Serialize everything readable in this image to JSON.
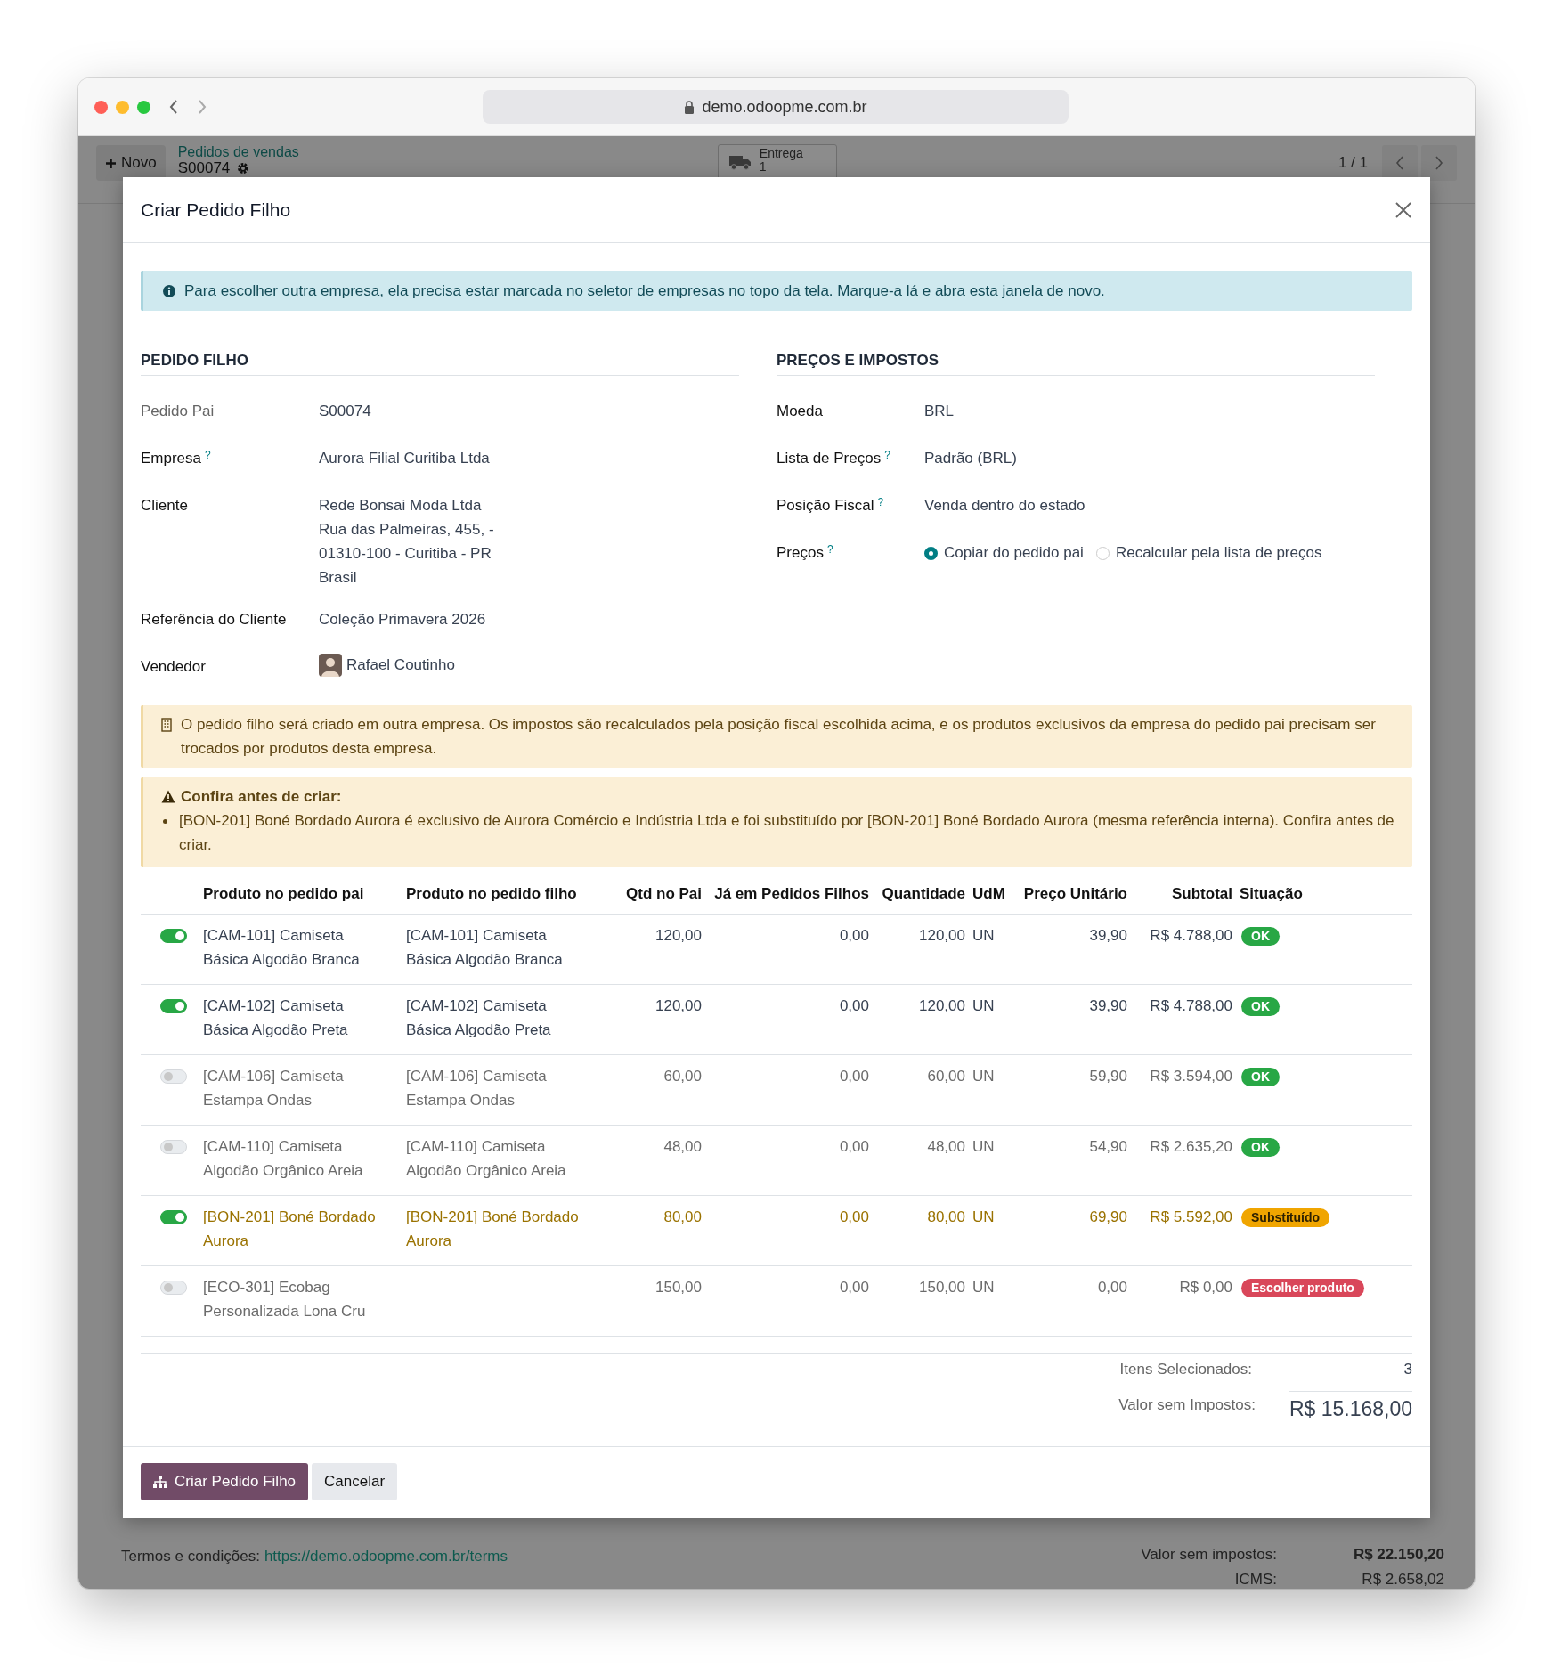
{
  "browser": {
    "url": "demo.odoopme.com.br"
  },
  "background": {
    "new_button": "Novo",
    "breadcrumb": "Pedidos de vendas",
    "record": "S00074",
    "smart_button": {
      "label": "Entrega",
      "count": "1"
    },
    "pager": "1 / 1",
    "terms_label": "Termos e condições:",
    "terms_link": "https://demo.odoopme.com.br/terms",
    "totals": [
      {
        "label": "Valor sem impostos:",
        "value": "R$ 22.150,20",
        "strong": true
      },
      {
        "label": "ICMS:",
        "value": "R$ 2.658,02",
        "strong": false
      }
    ]
  },
  "dialog": {
    "title": "Criar Pedido Filho",
    "info": "Para escolher outra empresa, ela precisa estar marcada no seletor de empresas no topo da tela. Marque-a lá e abra esta janela de novo.",
    "left_section": {
      "title": "PEDIDO FILHO",
      "fields": [
        {
          "label": "Pedido Pai",
          "muted": true,
          "kind": "text",
          "value": "S00074"
        },
        {
          "label": "Empresa",
          "help": "?",
          "muted": false,
          "kind": "text",
          "value": "Aurora Filial Curitiba Ltda"
        },
        {
          "label": "Cliente",
          "muted": false,
          "kind": "address",
          "lines": [
            "Rede Bonsai Moda Ltda",
            "Rua das Palmeiras, 455, -",
            "01310-100 - Curitiba - PR",
            "Brasil"
          ]
        },
        {
          "label": "Referência do Cliente",
          "muted": false,
          "kind": "text",
          "value": "Coleção Primavera 2026"
        },
        {
          "label": "Vendedor",
          "muted": false,
          "kind": "user",
          "value": "Rafael Coutinho"
        }
      ]
    },
    "right_section": {
      "title": "PREÇOS E IMPOSTOS",
      "fields": [
        {
          "label": "Moeda",
          "muted": false,
          "kind": "text",
          "value": "BRL"
        },
        {
          "label": "Lista de Preços",
          "help": "?",
          "muted": false,
          "kind": "text",
          "value": "Padrão (BRL)"
        },
        {
          "label": "Posição Fiscal",
          "help": "?",
          "muted": false,
          "kind": "text",
          "value": "Venda dentro do estado"
        },
        {
          "label": "Preços",
          "help": "?",
          "muted": false,
          "kind": "radio",
          "options": [
            {
              "label": "Copiar do pedido pai",
              "selected": true
            },
            {
              "label": "Recalcular pela lista de preços",
              "selected": false
            }
          ]
        }
      ]
    },
    "company_notice": "O pedido filho será criado em outra empresa. Os impostos são recalculados pela posição fiscal escolhida acima, e os produtos exclusivos da empresa do pedido pai precisam ser trocados por produtos desta empresa.",
    "check_notice": {
      "title": "Confira antes de criar:",
      "items": [
        "[BON-201] Boné Bordado Aurora é exclusivo de Aurora Comércio e Indústria Ltda e foi substituído por [BON-201] Boné Bordado Aurora (mesma referência interna). Confira antes de criar."
      ]
    },
    "table": {
      "columns": [
        "Produto no pedido pai",
        "Produto no pedido filho",
        "Qtd no Pai",
        "Já em Pedidos Filhos",
        "Quantidade",
        "UdM",
        "Preço Unitário",
        "Subtotal",
        "Situação"
      ],
      "rows": [
        {
          "selected": true,
          "parent_product": "[CAM-101] Camiseta Básica Algodão Branca",
          "child_product": "[CAM-101] Camiseta Básica Algodão Branca",
          "qty_parent": "120,00",
          "already": "0,00",
          "quantity": "120,00",
          "uom": "UN",
          "unit_price": "39,90",
          "subtotal": "R$ 4.788,00",
          "status": {
            "label": "OK",
            "kind": "ok"
          }
        },
        {
          "selected": true,
          "parent_product": "[CAM-102] Camiseta Básica Algodão Preta",
          "child_product": "[CAM-102] Camiseta Básica Algodão Preta",
          "qty_parent": "120,00",
          "already": "0,00",
          "quantity": "120,00",
          "uom": "UN",
          "unit_price": "39,90",
          "subtotal": "R$ 4.788,00",
          "status": {
            "label": "OK",
            "kind": "ok"
          }
        },
        {
          "selected": false,
          "parent_product": "[CAM-106] Camiseta Estampa Ondas",
          "child_product": "[CAM-106] Camiseta Estampa Ondas",
          "qty_parent": "60,00",
          "already": "0,00",
          "quantity": "60,00",
          "uom": "UN",
          "unit_price": "59,90",
          "subtotal": "R$ 3.594,00",
          "status": {
            "label": "OK",
            "kind": "ok"
          }
        },
        {
          "selected": false,
          "parent_product": "[CAM-110] Camiseta Algodão Orgânico Areia",
          "child_product": "[CAM-110] Camiseta Algodão Orgânico Areia",
          "qty_parent": "48,00",
          "already": "0,00",
          "quantity": "48,00",
          "uom": "UN",
          "unit_price": "54,90",
          "subtotal": "R$ 2.635,20",
          "status": {
            "label": "OK",
            "kind": "ok"
          }
        },
        {
          "selected": true,
          "parent_product": "[BON-201] Boné Bordado Aurora",
          "child_product": "[BON-201] Boné Bordado Aurora",
          "qty_parent": "80,00",
          "already": "0,00",
          "quantity": "80,00",
          "uom": "UN",
          "unit_price": "69,90",
          "subtotal": "R$ 5.592,00",
          "status": {
            "label": "Substituído",
            "kind": "replaced"
          }
        },
        {
          "selected": false,
          "parent_product": "[ECO-301] Ecobag Personalizada Lona Cru",
          "qty_parent": "150,00",
          "already": "0,00",
          "quantity": "150,00",
          "uom": "UN",
          "unit_price": "0,00",
          "subtotal": "R$ 0,00",
          "status": {
            "label": "Escolher produto",
            "kind": "missing"
          }
        }
      ]
    },
    "summary": [
      {
        "label": "Itens Selecionados:",
        "value": "3",
        "kind": "count"
      },
      {
        "label": "Valor sem Impostos:",
        "value": "R$ 15.168,00",
        "kind": "total"
      }
    ],
    "buttons": [
      {
        "label": "Criar Pedido Filho",
        "kind": "primary"
      },
      {
        "label": "Cancelar",
        "kind": "secondary"
      }
    ]
  }
}
